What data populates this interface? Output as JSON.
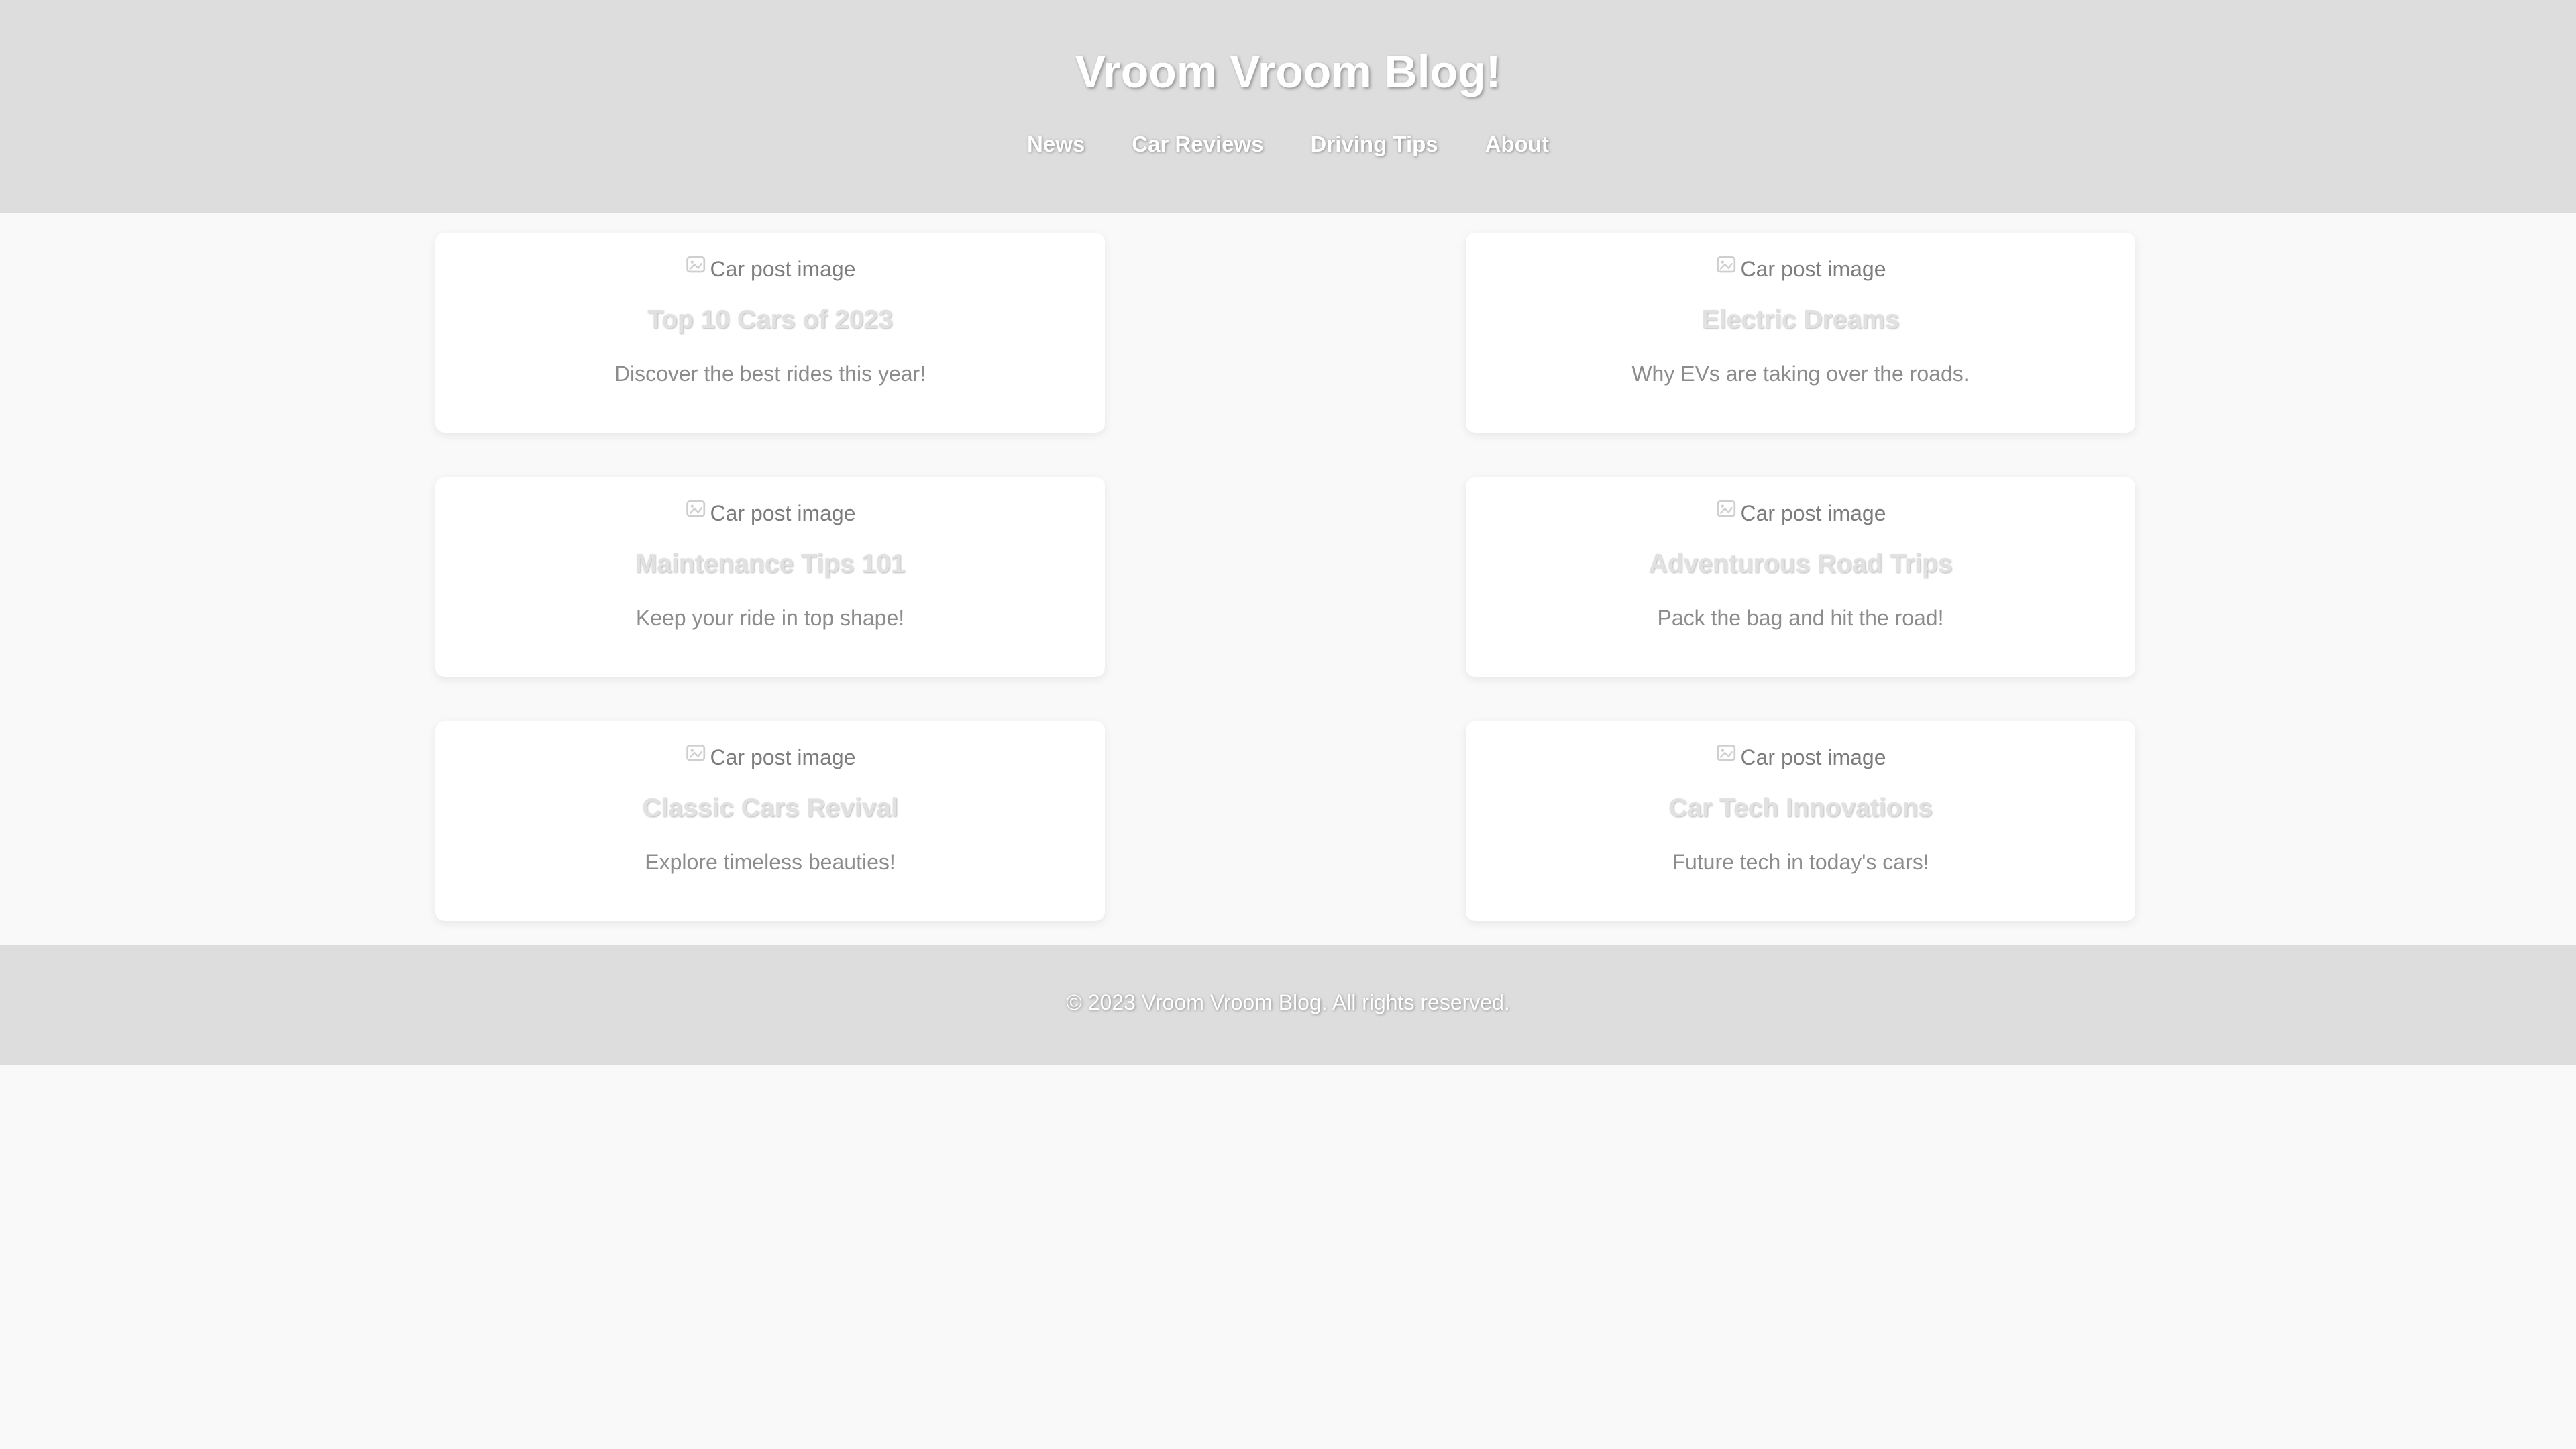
{
  "header": {
    "title": "Vroom Vroom Blog!",
    "nav": [
      {
        "label": "News"
      },
      {
        "label": "Car Reviews"
      },
      {
        "label": "Driving Tips"
      },
      {
        "label": "About"
      }
    ]
  },
  "posts": [
    {
      "image_alt": "Car post image",
      "title": "Top 10 Cars of 2023",
      "description": "Discover the best rides this year!"
    },
    {
      "image_alt": "Car post image",
      "title": "Electric Dreams",
      "description": "Why EVs are taking over the roads."
    },
    {
      "image_alt": "Car post image",
      "title": "Maintenance Tips 101",
      "description": "Keep your ride in top shape!"
    },
    {
      "image_alt": "Car post image",
      "title": "Adventurous Road Trips",
      "description": "Pack the bag and hit the road!"
    },
    {
      "image_alt": "Car post image",
      "title": "Classic Cars Revival",
      "description": "Explore timeless beauties!"
    },
    {
      "image_alt": "Car post image",
      "title": "Car Tech Innovations",
      "description": "Future tech in today's cars!"
    }
  ],
  "footer": {
    "text": "© 2023 Vroom Vroom Blog. All rights reserved."
  },
  "colors": {
    "header_bg": "#dddddd",
    "page_bg": "#f9f9f9",
    "card_bg": "#ffffff"
  },
  "icons": {
    "card_image": "broken-image-icon"
  }
}
